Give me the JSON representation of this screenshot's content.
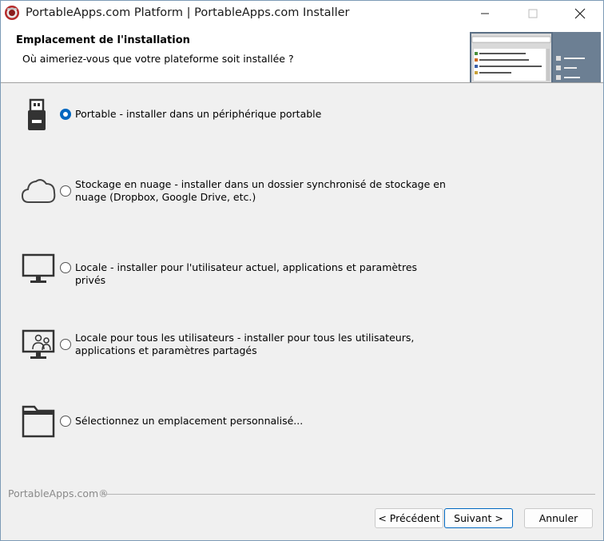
{
  "window": {
    "title": "PortableApps.com Platform | PortableApps.com Installer"
  },
  "header": {
    "title": "Emplacement de l'installation",
    "subtitle": "Où aimeriez-vous que votre plateforme soit installée ?"
  },
  "options": [
    {
      "label": "Portable - installer dans un périphérique portable",
      "icon": "usb-drive-icon",
      "checked": true
    },
    {
      "label": "Stockage en nuage - installer dans un dossier synchronisé de stockage en nuage (Dropbox, Google Drive, etc.)",
      "icon": "cloud-icon",
      "checked": false
    },
    {
      "label": "Locale - installer pour l'utilisateur actuel, applications et paramètres privés",
      "icon": "monitor-icon",
      "checked": false
    },
    {
      "label": "Locale pour tous les utilisateurs - installer pour tous les utilisateurs, applications et paramètres partagés",
      "icon": "monitor-users-icon",
      "checked": false
    },
    {
      "label": "Sélectionnez un emplacement personnalisé...",
      "icon": "folder-icon",
      "checked": false
    }
  ],
  "footer": {
    "brand": "PortableApps.com®",
    "back_label": "< Précédent",
    "next_label": "Suivant >",
    "cancel_label": "Annuler"
  },
  "colors": {
    "accent": "#0067c0",
    "header_bg": "#ffffff",
    "body_bg": "#f0f0f0"
  }
}
